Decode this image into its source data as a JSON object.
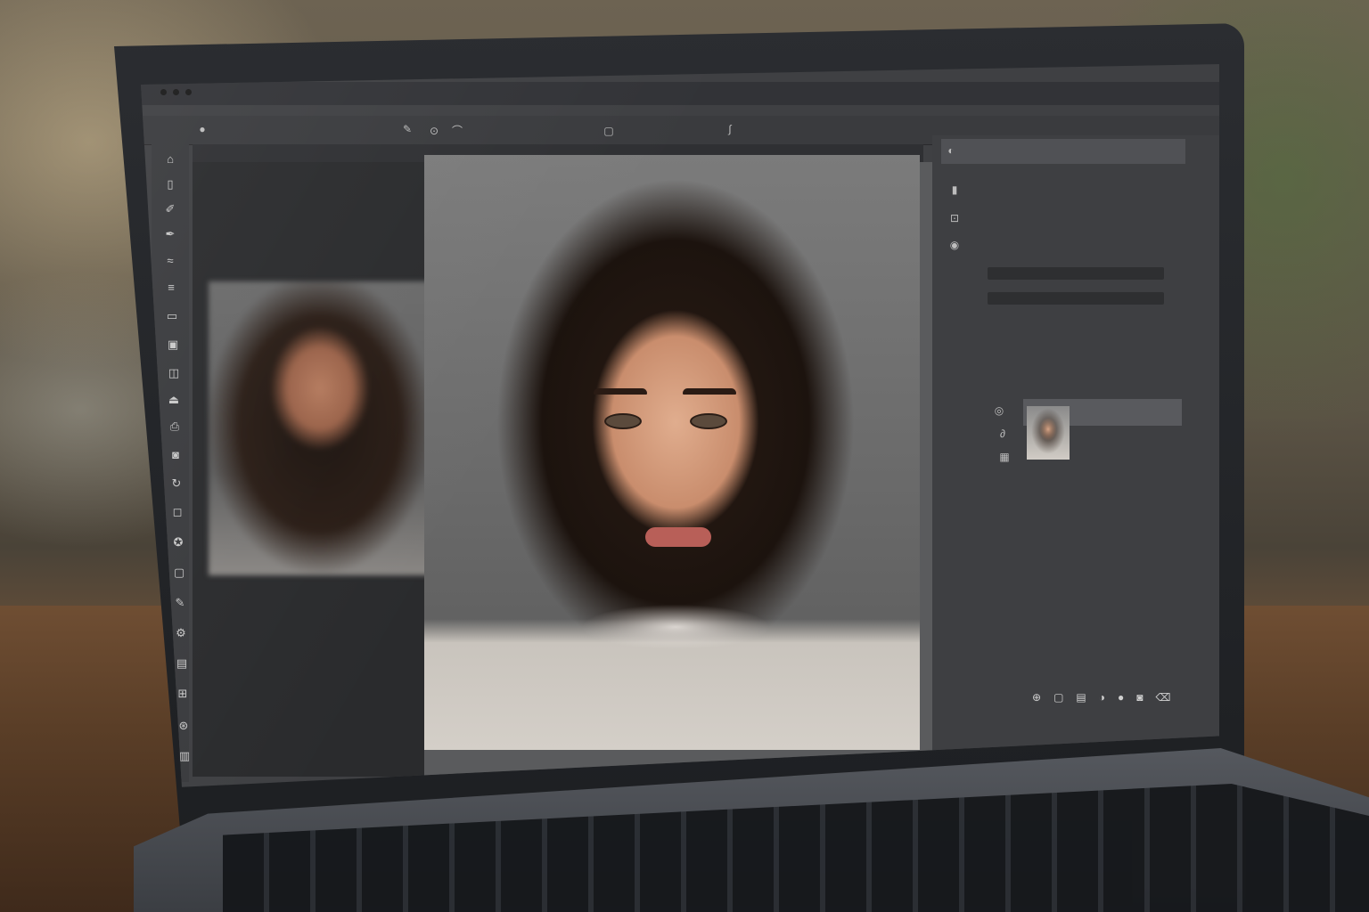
{
  "app": {
    "title": "",
    "menu": [],
    "workspace_label": ""
  },
  "options_bar": {
    "items": []
  },
  "toolbar": {
    "tools": [
      "move-tool-icon",
      "marquee-tool-icon",
      "lasso-tool-icon",
      "quick-selection-tool-icon",
      "crop-tool-icon",
      "eyedropper-tool-icon",
      "healing-brush-icon",
      "brush-tool-icon",
      "clone-stamp-icon",
      "history-brush-icon",
      "eraser-tool-icon",
      "gradient-tool-icon",
      "blur-tool-icon",
      "dodge-tool-icon",
      "pen-tool-icon",
      "type-tool-icon",
      "path-selection-icon",
      "shape-tool-icon",
      "hand-tool-icon",
      "zoom-tool-icon"
    ]
  },
  "documents": {
    "tabs": []
  },
  "right_panel": {
    "header": "",
    "rows": [],
    "layer_name": ""
  },
  "status_bar": {
    "text": ""
  },
  "colors": {
    "panel_dark": "#2a2b2d",
    "panel": "#3e3f42",
    "chrome": "#3a3b3e",
    "text": "#c8c8c8"
  }
}
